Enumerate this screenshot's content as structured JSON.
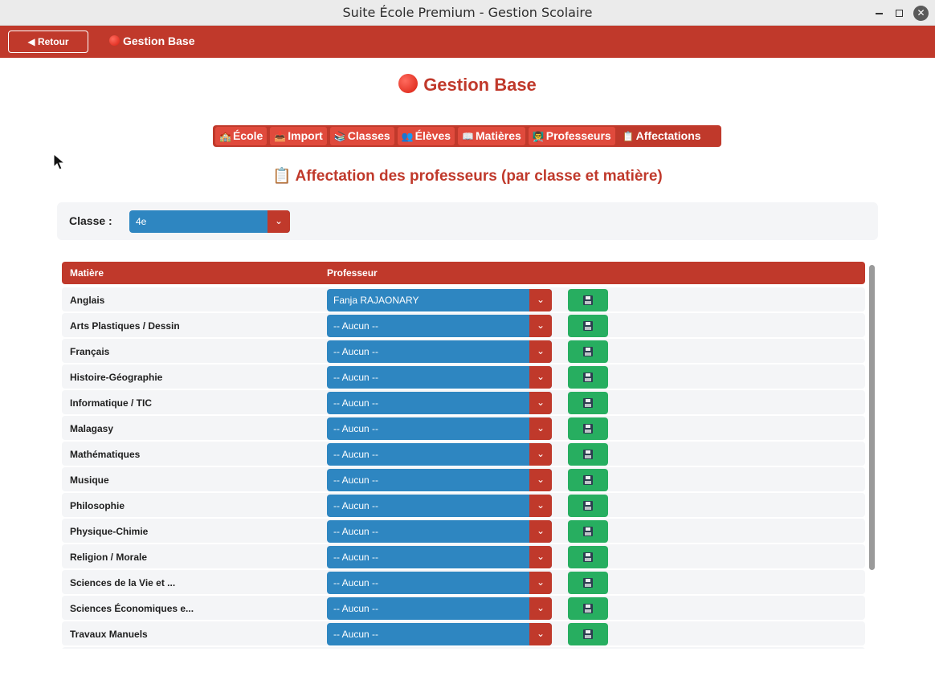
{
  "window": {
    "title": "Suite École Premium - Gestion Scolaire"
  },
  "appbar": {
    "back_label": "◀ Retour",
    "title": "Gestion Base"
  },
  "page": {
    "title": "Gestion Base"
  },
  "tabs": [
    {
      "icon": "🏫",
      "label": "École"
    },
    {
      "icon": "📥",
      "label": "Import"
    },
    {
      "icon": "📚",
      "label": "Classes"
    },
    {
      "icon": "👥",
      "label": "Élèves"
    },
    {
      "icon": "📖",
      "label": "Matières"
    },
    {
      "icon": "👨‍🏫",
      "label": "Professeurs"
    },
    {
      "icon": "📋",
      "label": "Affectations"
    }
  ],
  "section": {
    "title": "📋 Affectation des professeurs (par classe et matière)"
  },
  "filter": {
    "label": "Classe :",
    "value": "4e"
  },
  "table": {
    "headers": [
      "Matière",
      "Professeur"
    ],
    "rows": [
      {
        "subject": "Anglais",
        "teacher": "Fanja RAJAONARY"
      },
      {
        "subject": "Arts Plastiques / Dessin",
        "teacher": "-- Aucun --"
      },
      {
        "subject": "Français",
        "teacher": "-- Aucun --"
      },
      {
        "subject": "Histoire-Géographie",
        "teacher": "-- Aucun --"
      },
      {
        "subject": "Informatique / TIC",
        "teacher": "-- Aucun --"
      },
      {
        "subject": "Malagasy",
        "teacher": "-- Aucun --"
      },
      {
        "subject": "Mathématiques",
        "teacher": "-- Aucun --"
      },
      {
        "subject": "Musique",
        "teacher": "-- Aucun --"
      },
      {
        "subject": "Philosophie",
        "teacher": "-- Aucun --"
      },
      {
        "subject": "Physique-Chimie",
        "teacher": "-- Aucun --"
      },
      {
        "subject": "Religion / Morale",
        "teacher": "-- Aucun --"
      },
      {
        "subject": "Sciences de la Vie et ...",
        "teacher": "-- Aucun --"
      },
      {
        "subject": "Sciences Économiques e...",
        "teacher": "-- Aucun --"
      },
      {
        "subject": "Travaux Manuels",
        "teacher": "-- Aucun --"
      },
      {
        "subject": "",
        "teacher": ""
      }
    ]
  },
  "colors": {
    "accent": "#c0392b",
    "select": "#2e86c1",
    "save": "#27ae60",
    "row_bg": "#f4f5f7"
  }
}
